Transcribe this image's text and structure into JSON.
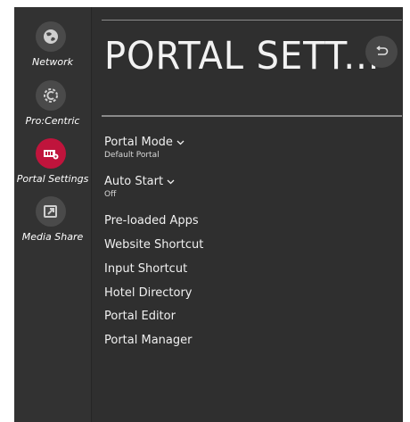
{
  "sidebar": {
    "items": [
      {
        "label": "Network",
        "icon": "network-icon"
      },
      {
        "label": "Pro:Centric",
        "icon": "procentric-icon"
      },
      {
        "label": "Portal Settings",
        "icon": "portal-settings-icon",
        "active": true
      },
      {
        "label": "Media Share",
        "icon": "media-share-icon"
      }
    ]
  },
  "header": {
    "title": "PORTAL SETT...",
    "back_icon": "back-arrow-icon"
  },
  "menu": {
    "portal_mode": {
      "label": "Portal Mode",
      "value": "Default Portal"
    },
    "auto_start": {
      "label": "Auto Start",
      "value": "Off"
    },
    "preloaded_apps": "Pre-loaded Apps",
    "website_shortcut": "Website Shortcut",
    "input_shortcut": "Input Shortcut",
    "hotel_directory": "Hotel Directory",
    "portal_editor": "Portal Editor",
    "portal_manager": "Portal Manager"
  },
  "colors": {
    "background": "#2f2f2f",
    "sidebar": "#323232",
    "accent": "#c0143c",
    "icon_bg": "#4a4a4a",
    "text": "#f0f0f0"
  }
}
